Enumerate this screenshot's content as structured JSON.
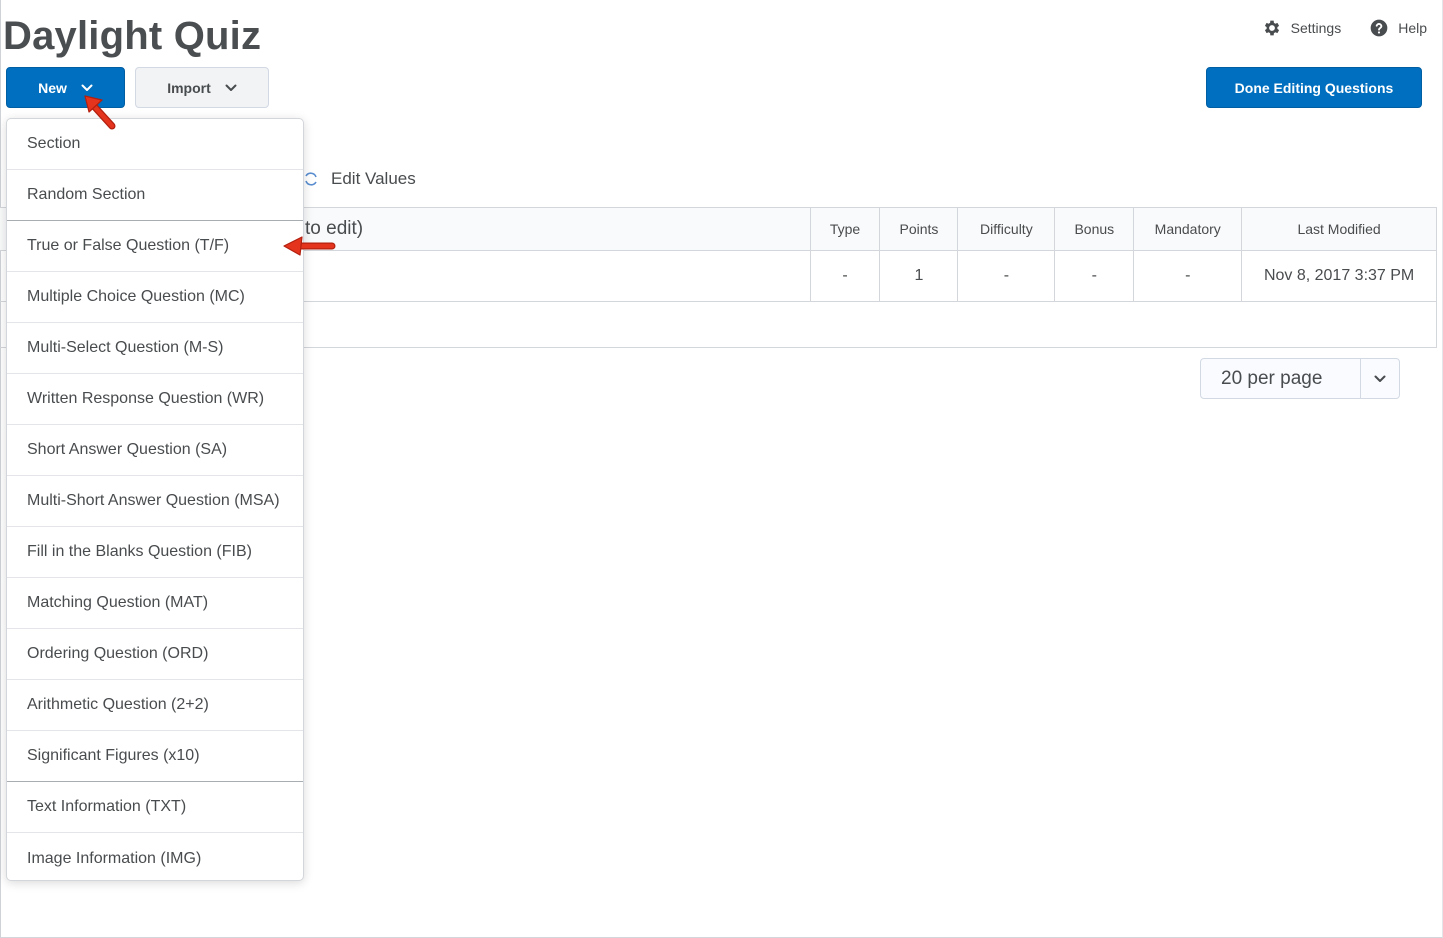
{
  "page": {
    "title": "Daylight Quiz"
  },
  "top_links": {
    "settings": "Settings",
    "help": "Help"
  },
  "toolbar": {
    "new_label": "New",
    "import_label": "Import",
    "done_label": "Done Editing Questions"
  },
  "edit_values": {
    "label": "Edit Values"
  },
  "table": {
    "partial_first_header": "to edit)",
    "columns": [
      "Type",
      "Points",
      "Difficulty",
      "Bonus",
      "Mandatory",
      "Last Modified"
    ],
    "rows": [
      {
        "type": "-",
        "points": "1",
        "difficulty": "-",
        "bonus": "-",
        "mandatory": "-",
        "last_modified": "Nov 8, 2017 3:37 PM"
      }
    ]
  },
  "pagination": {
    "per_page": "20 per page"
  },
  "new_menu": {
    "items": [
      "Section",
      "Random Section",
      "True or False Question (T/F)",
      "Multiple Choice Question (MC)",
      "Multi-Select Question (M-S)",
      "Written Response Question (WR)",
      "Short Answer Question (SA)",
      "Multi-Short Answer Question (MSA)",
      "Fill in the Blanks Question (FIB)",
      "Matching Question (MAT)",
      "Ordering Question (ORD)",
      "Arithmetic Question (2+2)",
      "Significant Figures (x10)",
      "Text Information (TXT)",
      "Image Information (IMG)"
    ]
  },
  "colors": {
    "primary": "#006fbf",
    "text": "#494c4e",
    "annotation_arrow": "#e5341d"
  },
  "icons": {
    "settings": "gear-icon",
    "help": "question-circle-icon",
    "edit_values": "refresh-icon",
    "dropdown": "chevron-down-icon"
  }
}
